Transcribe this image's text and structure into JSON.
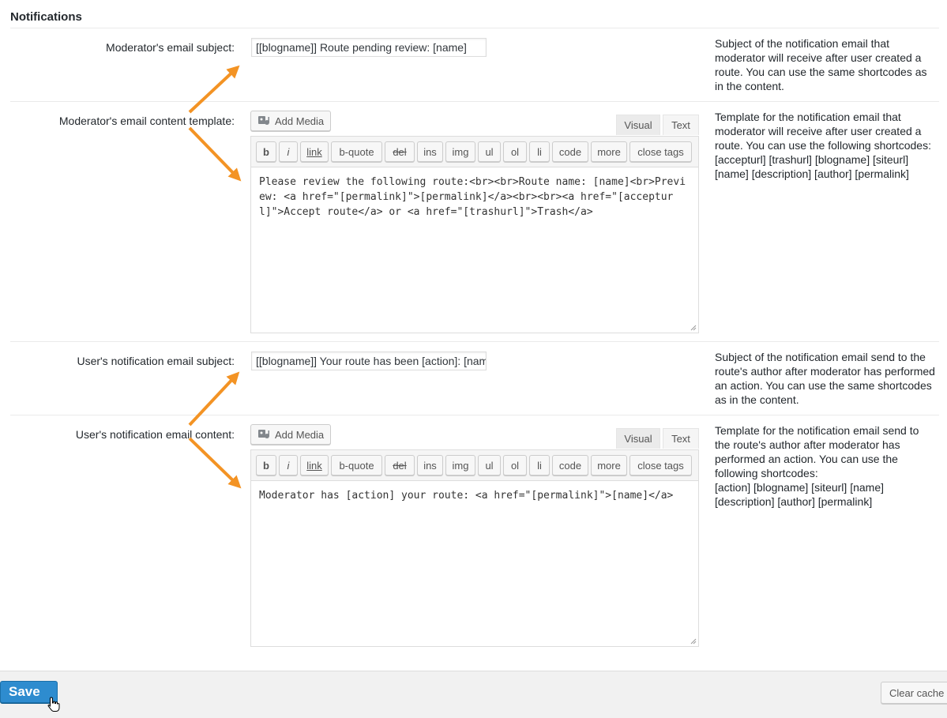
{
  "section": {
    "title": "Notifications"
  },
  "rows": {
    "moderator_subject": {
      "label": "Moderator's email subject:",
      "value": "[[blogname]] Route pending review: [name]",
      "description": "Subject of the notification email that moderator will receive after user created a route. You can use the same shortcodes as in the content."
    },
    "moderator_content": {
      "label": "Moderator's email content template:",
      "description": "Template for the notification email that moderator will receive after user created a route. You can use the following shortcodes:\n[accepturl] [trashurl] [blogname] [siteurl] [name] [description] [author] [permalink]",
      "content": "Please review the following route:<br><br>Route name: [name]<br>Preview: <a href=\"[permalink]\">[permalink]</a><br><br><a href=\"[accepturl]\">Accept route</a> or <a href=\"[trashurl]\">Trash</a>"
    },
    "user_subject": {
      "label": "User's notification email subject:",
      "value": "[[blogname]] Your route has been [action]: [name]",
      "description": "Subject of the notification email send to the route's author after moderator has performed an action. You can use the same shortcodes as in the content."
    },
    "user_content": {
      "label": "User's notification email content:",
      "description": "Template for the notification email send to the route's author after moderator has performed an action. You can use the following shortcodes:\n[action] [blogname] [siteurl] [name] [description] [author] [permalink]",
      "content": "Moderator has [action] your route: <a href=\"[permalink]\">[name]</a>"
    }
  },
  "editor": {
    "add_media": "Add Media",
    "tab_visual": "Visual",
    "tab_text": "Text",
    "quicktags": [
      "b",
      "i",
      "link",
      "b-quote",
      "del",
      "ins",
      "img",
      "ul",
      "ol",
      "li",
      "code",
      "more",
      "close tags"
    ]
  },
  "footer": {
    "save": "Save",
    "clear_cache": "Clear cache"
  },
  "colors": {
    "accent_arrow": "#f39324",
    "save_button": "#2e8ccf"
  }
}
